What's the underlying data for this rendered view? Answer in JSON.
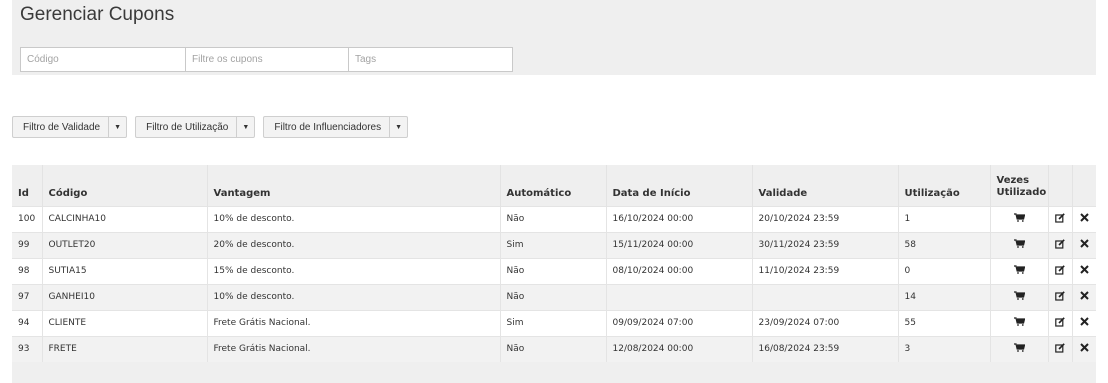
{
  "page": {
    "title": "Gerenciar Cupons"
  },
  "filters": {
    "code_placeholder": "Código",
    "coupon_placeholder": "Filtre os cupons",
    "tags_placeholder": "Tags"
  },
  "dropdowns": [
    {
      "label": "Filtro de Validade"
    },
    {
      "label": "Filtro de Utilização"
    },
    {
      "label": "Filtro de Influenciadores"
    }
  ],
  "table": {
    "headers": {
      "id": "Id",
      "code": "Código",
      "advantage": "Vantagem",
      "automatic": "Automático",
      "start": "Data de Início",
      "validity": "Validade",
      "usage": "Utilização",
      "times_used": "Vezes Utilizado"
    },
    "rows": [
      {
        "id": "100",
        "code": "CALCINHA10",
        "advantage": "10% de desconto.",
        "automatic": "Não",
        "start": "16/10/2024 00:00",
        "validity": "20/10/2024 23:59",
        "usage": "1"
      },
      {
        "id": "99",
        "code": "OUTLET20",
        "advantage": "20% de desconto.",
        "automatic": "Sim",
        "start": "15/11/2024 00:00",
        "validity": "30/11/2024 23:59",
        "usage": "58"
      },
      {
        "id": "98",
        "code": "SUTIA15",
        "advantage": "15% de desconto.",
        "automatic": "Não",
        "start": "08/10/2024 00:00",
        "validity": "11/10/2024 23:59",
        "usage": "0"
      },
      {
        "id": "97",
        "code": "GANHEI10",
        "advantage": "10% de desconto.",
        "automatic": "Não",
        "start": "",
        "validity": "",
        "usage": "14"
      },
      {
        "id": "94",
        "code": "CLIENTE",
        "advantage": "Frete Grátis Nacional.",
        "automatic": "Sim",
        "start": "09/09/2024 07:00",
        "validity": "23/09/2024 07:00",
        "usage": "55"
      },
      {
        "id": "93",
        "code": "FRETE",
        "advantage": "Frete Grátis Nacional.",
        "automatic": "Não",
        "start": "12/08/2024 00:00",
        "validity": "16/08/2024 23:59",
        "usage": "3"
      }
    ],
    "row_icons": [
      "cart-icon",
      "edit-icon",
      "delete-icon"
    ]
  }
}
